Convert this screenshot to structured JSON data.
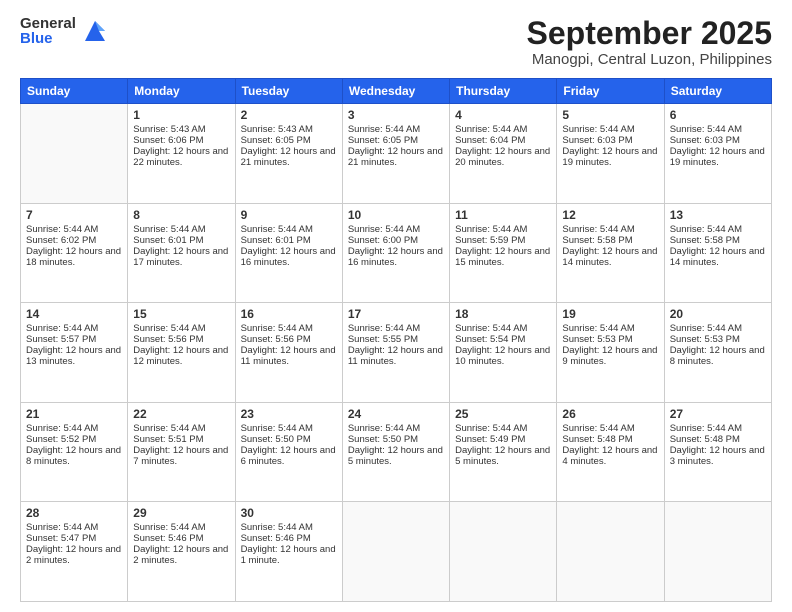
{
  "logo": {
    "general": "General",
    "blue": "Blue"
  },
  "header": {
    "month": "September 2025",
    "location": "Manogpi, Central Luzon, Philippines"
  },
  "days_of_week": [
    "Sunday",
    "Monday",
    "Tuesday",
    "Wednesday",
    "Thursday",
    "Friday",
    "Saturday"
  ],
  "weeks": [
    [
      {
        "day": "",
        "sunrise": "",
        "sunset": "",
        "daylight": ""
      },
      {
        "day": "1",
        "sunrise": "Sunrise: 5:43 AM",
        "sunset": "Sunset: 6:06 PM",
        "daylight": "Daylight: 12 hours and 22 minutes."
      },
      {
        "day": "2",
        "sunrise": "Sunrise: 5:43 AM",
        "sunset": "Sunset: 6:05 PM",
        "daylight": "Daylight: 12 hours and 21 minutes."
      },
      {
        "day": "3",
        "sunrise": "Sunrise: 5:44 AM",
        "sunset": "Sunset: 6:05 PM",
        "daylight": "Daylight: 12 hours and 21 minutes."
      },
      {
        "day": "4",
        "sunrise": "Sunrise: 5:44 AM",
        "sunset": "Sunset: 6:04 PM",
        "daylight": "Daylight: 12 hours and 20 minutes."
      },
      {
        "day": "5",
        "sunrise": "Sunrise: 5:44 AM",
        "sunset": "Sunset: 6:03 PM",
        "daylight": "Daylight: 12 hours and 19 minutes."
      },
      {
        "day": "6",
        "sunrise": "Sunrise: 5:44 AM",
        "sunset": "Sunset: 6:03 PM",
        "daylight": "Daylight: 12 hours and 19 minutes."
      }
    ],
    [
      {
        "day": "7",
        "sunrise": "Sunrise: 5:44 AM",
        "sunset": "Sunset: 6:02 PM",
        "daylight": "Daylight: 12 hours and 18 minutes."
      },
      {
        "day": "8",
        "sunrise": "Sunrise: 5:44 AM",
        "sunset": "Sunset: 6:01 PM",
        "daylight": "Daylight: 12 hours and 17 minutes."
      },
      {
        "day": "9",
        "sunrise": "Sunrise: 5:44 AM",
        "sunset": "Sunset: 6:01 PM",
        "daylight": "Daylight: 12 hours and 16 minutes."
      },
      {
        "day": "10",
        "sunrise": "Sunrise: 5:44 AM",
        "sunset": "Sunset: 6:00 PM",
        "daylight": "Daylight: 12 hours and 16 minutes."
      },
      {
        "day": "11",
        "sunrise": "Sunrise: 5:44 AM",
        "sunset": "Sunset: 5:59 PM",
        "daylight": "Daylight: 12 hours and 15 minutes."
      },
      {
        "day": "12",
        "sunrise": "Sunrise: 5:44 AM",
        "sunset": "Sunset: 5:58 PM",
        "daylight": "Daylight: 12 hours and 14 minutes."
      },
      {
        "day": "13",
        "sunrise": "Sunrise: 5:44 AM",
        "sunset": "Sunset: 5:58 PM",
        "daylight": "Daylight: 12 hours and 14 minutes."
      }
    ],
    [
      {
        "day": "14",
        "sunrise": "Sunrise: 5:44 AM",
        "sunset": "Sunset: 5:57 PM",
        "daylight": "Daylight: 12 hours and 13 minutes."
      },
      {
        "day": "15",
        "sunrise": "Sunrise: 5:44 AM",
        "sunset": "Sunset: 5:56 PM",
        "daylight": "Daylight: 12 hours and 12 minutes."
      },
      {
        "day": "16",
        "sunrise": "Sunrise: 5:44 AM",
        "sunset": "Sunset: 5:56 PM",
        "daylight": "Daylight: 12 hours and 11 minutes."
      },
      {
        "day": "17",
        "sunrise": "Sunrise: 5:44 AM",
        "sunset": "Sunset: 5:55 PM",
        "daylight": "Daylight: 12 hours and 11 minutes."
      },
      {
        "day": "18",
        "sunrise": "Sunrise: 5:44 AM",
        "sunset": "Sunset: 5:54 PM",
        "daylight": "Daylight: 12 hours and 10 minutes."
      },
      {
        "day": "19",
        "sunrise": "Sunrise: 5:44 AM",
        "sunset": "Sunset: 5:53 PM",
        "daylight": "Daylight: 12 hours and 9 minutes."
      },
      {
        "day": "20",
        "sunrise": "Sunrise: 5:44 AM",
        "sunset": "Sunset: 5:53 PM",
        "daylight": "Daylight: 12 hours and 8 minutes."
      }
    ],
    [
      {
        "day": "21",
        "sunrise": "Sunrise: 5:44 AM",
        "sunset": "Sunset: 5:52 PM",
        "daylight": "Daylight: 12 hours and 8 minutes."
      },
      {
        "day": "22",
        "sunrise": "Sunrise: 5:44 AM",
        "sunset": "Sunset: 5:51 PM",
        "daylight": "Daylight: 12 hours and 7 minutes."
      },
      {
        "day": "23",
        "sunrise": "Sunrise: 5:44 AM",
        "sunset": "Sunset: 5:50 PM",
        "daylight": "Daylight: 12 hours and 6 minutes."
      },
      {
        "day": "24",
        "sunrise": "Sunrise: 5:44 AM",
        "sunset": "Sunset: 5:50 PM",
        "daylight": "Daylight: 12 hours and 5 minutes."
      },
      {
        "day": "25",
        "sunrise": "Sunrise: 5:44 AM",
        "sunset": "Sunset: 5:49 PM",
        "daylight": "Daylight: 12 hours and 5 minutes."
      },
      {
        "day": "26",
        "sunrise": "Sunrise: 5:44 AM",
        "sunset": "Sunset: 5:48 PM",
        "daylight": "Daylight: 12 hours and 4 minutes."
      },
      {
        "day": "27",
        "sunrise": "Sunrise: 5:44 AM",
        "sunset": "Sunset: 5:48 PM",
        "daylight": "Daylight: 12 hours and 3 minutes."
      }
    ],
    [
      {
        "day": "28",
        "sunrise": "Sunrise: 5:44 AM",
        "sunset": "Sunset: 5:47 PM",
        "daylight": "Daylight: 12 hours and 2 minutes."
      },
      {
        "day": "29",
        "sunrise": "Sunrise: 5:44 AM",
        "sunset": "Sunset: 5:46 PM",
        "daylight": "Daylight: 12 hours and 2 minutes."
      },
      {
        "day": "30",
        "sunrise": "Sunrise: 5:44 AM",
        "sunset": "Sunset: 5:46 PM",
        "daylight": "Daylight: 12 hours and 1 minute."
      },
      {
        "day": "",
        "sunrise": "",
        "sunset": "",
        "daylight": ""
      },
      {
        "day": "",
        "sunrise": "",
        "sunset": "",
        "daylight": ""
      },
      {
        "day": "",
        "sunrise": "",
        "sunset": "",
        "daylight": ""
      },
      {
        "day": "",
        "sunrise": "",
        "sunset": "",
        "daylight": ""
      }
    ]
  ]
}
